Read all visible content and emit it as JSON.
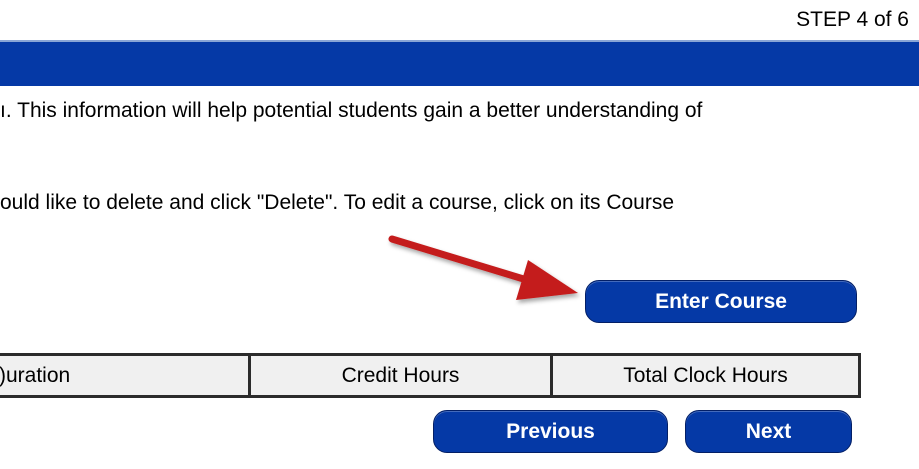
{
  "header": {
    "step_label": "STEP 4 of 6"
  },
  "instructions": {
    "line1": "ı. This information will help potential students gain a better understanding of",
    "line2": "ould like to delete and click \"Delete\". To edit a course, click on its Course"
  },
  "buttons": {
    "enter_course": "Enter Course",
    "previous": "Previous",
    "next": "Next"
  },
  "table": {
    "headers": [
      "Duration",
      "Credit Hours",
      "Total Clock Hours"
    ],
    "visible_first_header": ")uration"
  },
  "colors": {
    "accent_blue": "#0539a6",
    "arrow_red": "#c41a1a"
  }
}
